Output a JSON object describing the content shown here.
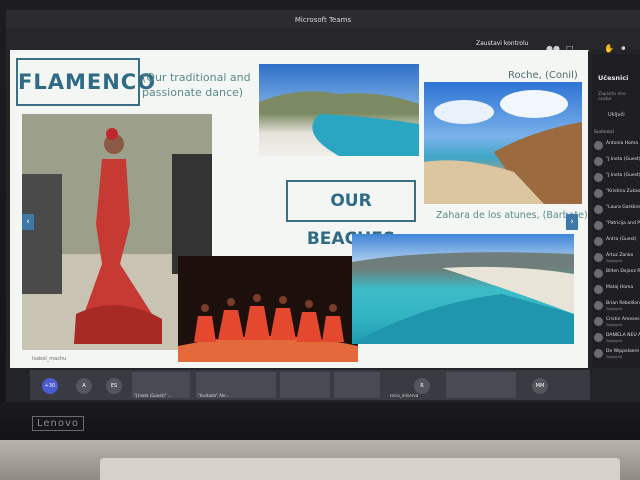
{
  "window": {
    "title": "Microsoft Teams"
  },
  "toolbar": {
    "leave_label": "Zaustavi kontrolu"
  },
  "slide": {
    "flamenco_title": "FLAMENCO",
    "flamenco_subtitle": "(Our traditional and passionate dance)",
    "beaches_title": "OUR BEACHES",
    "roche_label": "Roche, (Conil)",
    "zahara_label": "Zahara de los atunes, (Barbate)",
    "prev_arrow": "‹",
    "next_arrow": "›",
    "sharer_caption": "Isabel_machu"
  },
  "participants_panel": {
    "title": "Učesnici",
    "search_placeholder": "Zapisite ime osobe",
    "unmute_label": "Uključi",
    "section_label": "Sudionici",
    "people": [
      {
        "name": "Antonia Homa",
        "role": ""
      },
      {
        "name": "\"J.Ineta (Guest)\"",
        "role": ""
      },
      {
        "name": "\"J.Ineta (Guest)\"",
        "role": ""
      },
      {
        "name": "\"Kristina Zukas (G",
        "role": ""
      },
      {
        "name": "\"Laura Garkline and",
        "role": ""
      },
      {
        "name": "\"Patricija and Paula",
        "role": ""
      },
      {
        "name": "Antra (Guest)",
        "role": ""
      },
      {
        "name": "Artuz Zanko",
        "role": "Gostujući"
      },
      {
        "name": "Bilten Dejanz Ruzan",
        "role": ""
      },
      {
        "name": "Mataj Homa",
        "role": ""
      },
      {
        "name": "Brian Rebellion",
        "role": "Gostujući"
      },
      {
        "name": "Cristin Ameses",
        "role": "Gostujući"
      },
      {
        "name": "DANIELA NEU ANGHINA",
        "role": "Gostujući"
      },
      {
        "name": "De Wippelaere Sophie",
        "role": "Gostujući"
      }
    ]
  },
  "video_strip": {
    "tiles": [
      {
        "label": "+30",
        "color": "#4b5bd0"
      },
      {
        "label": "A",
        "color": "#55555e"
      },
      {
        "label": "ES",
        "color": "#55555e"
      },
      {
        "label": "\"J.Ineta (Guest)\" ..."
      },
      {
        "label": "\"Invitado\" Ale..."
      },
      {
        "label": ""
      },
      {
        "label": ""
      },
      {
        "label": "rocio_minerva"
      },
      {
        "label": "R",
        "color": "#55555e"
      },
      {
        "label": ""
      },
      {
        "label": "MM",
        "color": "#55555e"
      }
    ]
  },
  "device": {
    "brand": "Lenovo"
  },
  "colors": {
    "accent": "#2f6a86",
    "slide_bg": "#f4f6f3"
  }
}
